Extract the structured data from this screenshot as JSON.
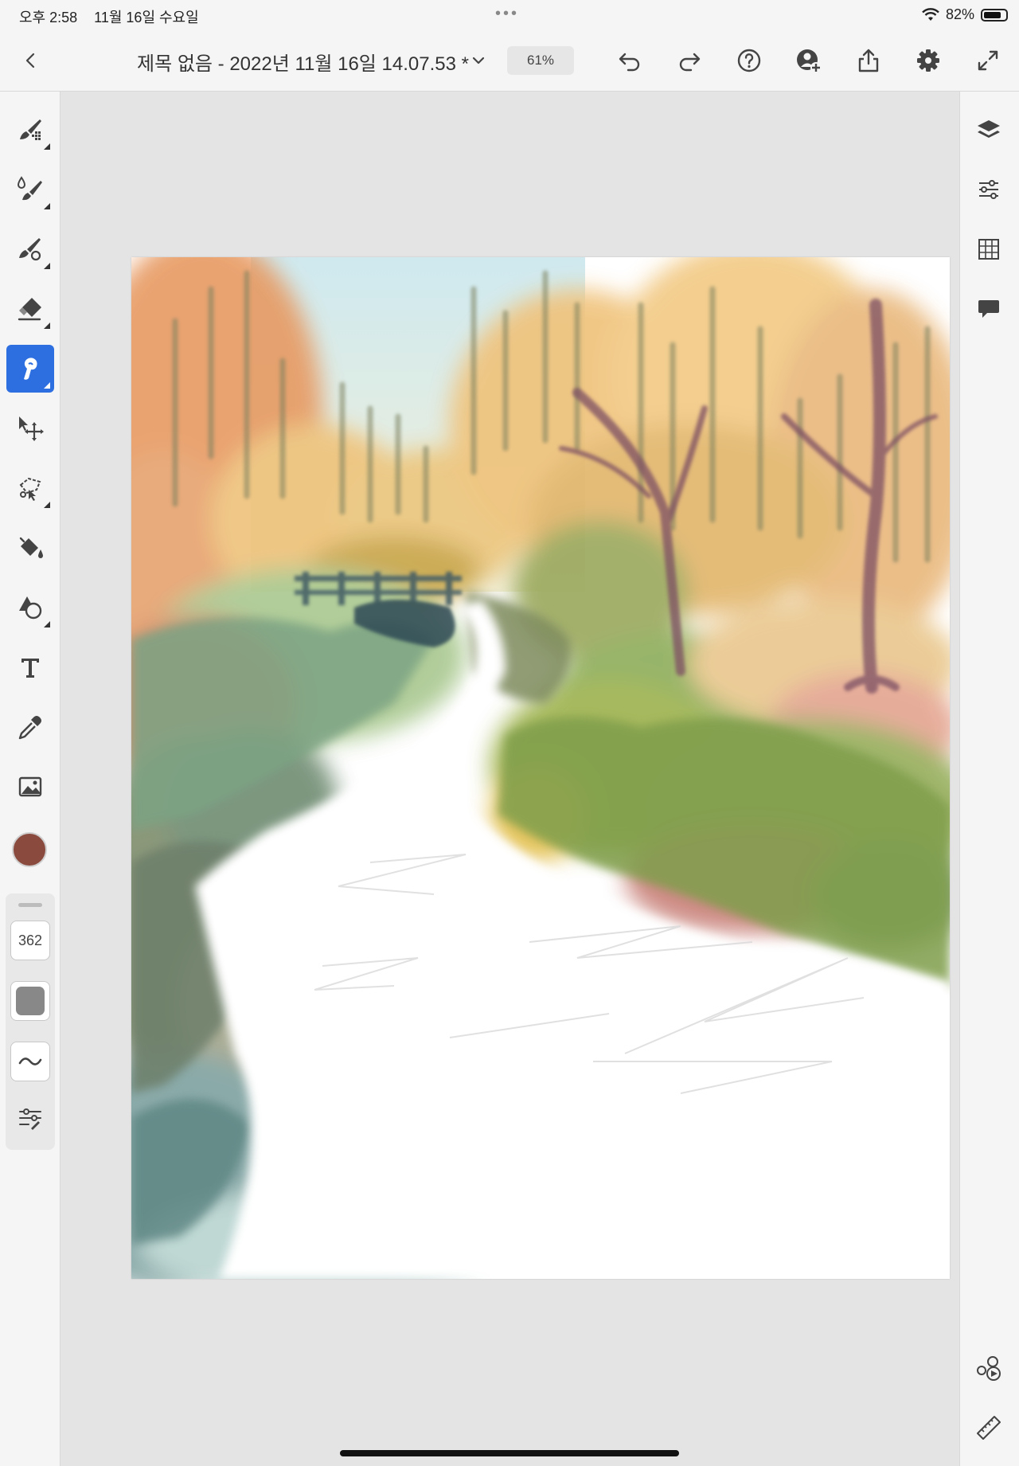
{
  "status_bar": {
    "time": "오후 2:58",
    "date": "11월 16일 수요일",
    "dots": "•••",
    "battery": "82%",
    "battery_level": 0.82
  },
  "toolbar": {
    "document_title": "제목 없음 - 2022년 11월 16일 14.07.53 *",
    "zoom": "61%",
    "icons": [
      "back-icon",
      "chevron-down-icon",
      "undo-icon",
      "redo-icon",
      "help-icon",
      "invite-user-icon",
      "share-icon",
      "settings-icon",
      "fullscreen-icon"
    ]
  },
  "left_tools": {
    "items": [
      "pixel-brush-icon",
      "live-brush-icon",
      "vector-brush-icon",
      "eraser-icon",
      "smudge-icon",
      "transform-icon",
      "lasso-select-icon",
      "fill-icon",
      "shapes-icon",
      "text-icon",
      "eyedropper-icon",
      "image-icon"
    ],
    "active": "smudge-icon",
    "accent_color": "#2d6fe0",
    "brush_color": "#8a4a3e"
  },
  "brush_properties": {
    "size": "362",
    "icons": [
      "opacity-icon",
      "flow-icon",
      "brush-settings-icon"
    ]
  },
  "right_tools": {
    "items": [
      "layers-icon",
      "adjustments-icon",
      "grid-icon",
      "comments-icon",
      "livestream-icon",
      "ruler-icon"
    ]
  }
}
